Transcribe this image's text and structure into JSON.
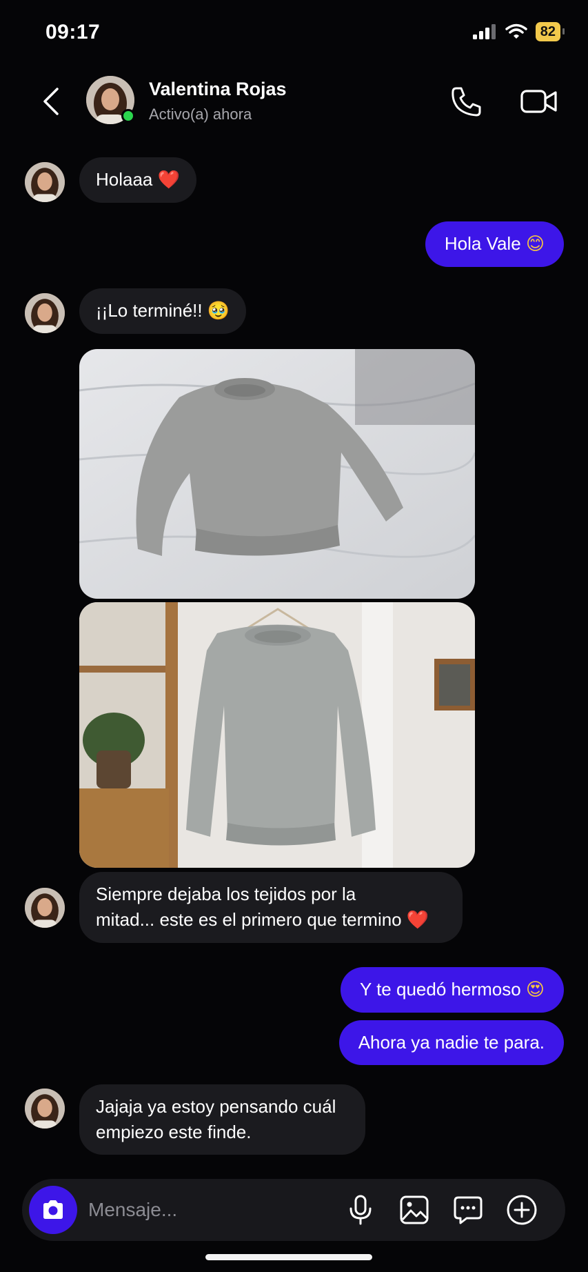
{
  "status_bar": {
    "time": "09:17",
    "battery": "82"
  },
  "header": {
    "contact_name": "Valentina Rojas",
    "contact_status": "Activo(a) ahora"
  },
  "messages": [
    {
      "direction": "in",
      "text": "Holaaa ",
      "emoji": "❤️"
    },
    {
      "direction": "out",
      "text": "Hola Vale ",
      "emoji": "😊"
    },
    {
      "direction": "in",
      "text": "¡¡Lo terminé!! ",
      "emoji": "🥹"
    },
    {
      "direction": "in",
      "type": "photo",
      "description": "sweater-on-bed"
    },
    {
      "direction": "in",
      "type": "photo",
      "description": "sweater-on-hanger"
    },
    {
      "direction": "in",
      "line1": "Siempre dejaba los tejidos por la",
      "line2": "mitad... este es el primero que termino ",
      "emoji": "❤️"
    },
    {
      "direction": "out",
      "text": "Y te quedó hermoso ",
      "emoji": "😍"
    },
    {
      "direction": "out",
      "text": "Ahora ya nadie te para."
    },
    {
      "direction": "in",
      "line1": "Jajaja ya estoy pensando cuál",
      "line2": "empiezo este finde."
    }
  ],
  "composer": {
    "placeholder": "Mensaje..."
  },
  "colors": {
    "accent": "#3d16e8",
    "incoming_bubble": "#1b1b1f",
    "background": "#050507",
    "online": "#2bd64e"
  }
}
